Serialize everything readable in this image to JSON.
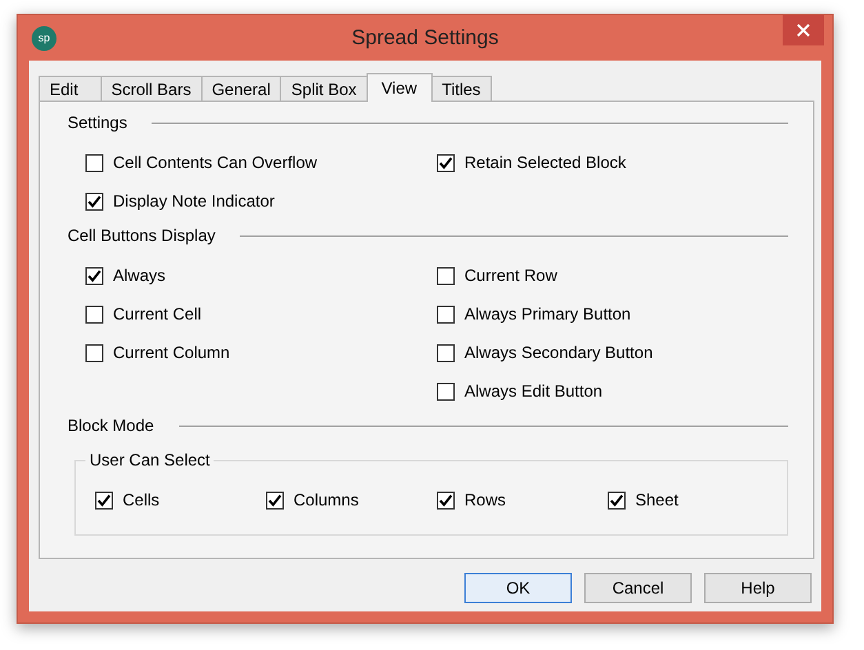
{
  "window": {
    "title": "Spread Settings",
    "app_badge": "sp"
  },
  "tabs": [
    {
      "label": "Edit",
      "selected": false
    },
    {
      "label": "Scroll Bars",
      "selected": false
    },
    {
      "label": "General",
      "selected": false
    },
    {
      "label": "Split Box",
      "selected": false
    },
    {
      "label": "View",
      "selected": true
    },
    {
      "label": "Titles",
      "selected": false
    }
  ],
  "sections": [
    {
      "label": "Settings",
      "columns": [
        [
          {
            "label": "Cell Contents Can Overflow",
            "checked": false
          },
          {
            "label": "Display Note Indicator",
            "checked": true
          }
        ],
        [
          {
            "label": "Retain Selected Block",
            "checked": true
          }
        ]
      ]
    },
    {
      "label": "Cell Buttons Display",
      "columns": [
        [
          {
            "label": "Always",
            "checked": true
          },
          {
            "label": "Current Cell",
            "checked": false
          },
          {
            "label": "Current Column",
            "checked": false
          }
        ],
        [
          {
            "label": "Current Row",
            "checked": false
          },
          {
            "label": "Always Primary Button",
            "checked": false
          },
          {
            "label": "Always Secondary Button",
            "checked": false
          },
          {
            "label": "Always Edit Button",
            "checked": false
          }
        ]
      ]
    }
  ],
  "block_mode": {
    "label": "Block Mode",
    "group": {
      "label": "User Can Select",
      "options": [
        {
          "label": "Cells",
          "checked": true
        },
        {
          "label": "Columns",
          "checked": true
        },
        {
          "label": "Rows",
          "checked": true
        },
        {
          "label": "Sheet",
          "checked": true
        }
      ]
    }
  },
  "buttons": [
    {
      "label": "OK",
      "default": true
    },
    {
      "label": "Cancel",
      "default": false
    },
    {
      "label": "Help",
      "default": false
    }
  ]
}
